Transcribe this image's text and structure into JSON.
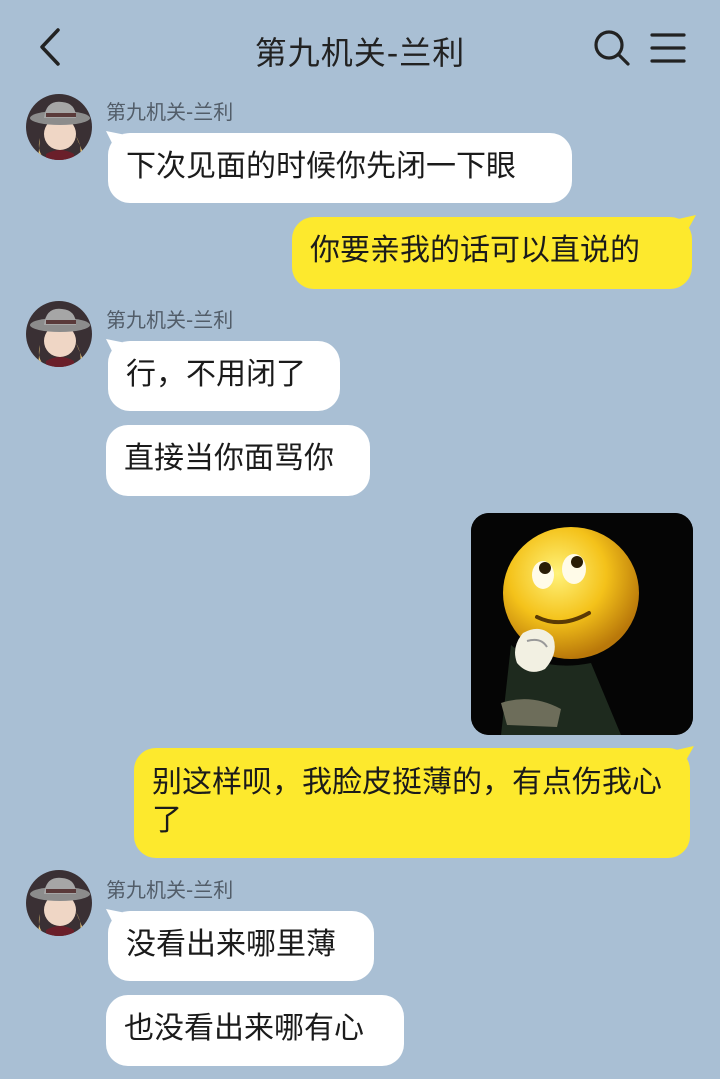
{
  "header": {
    "title": "第九机关-兰利",
    "back_icon": "chevron-left-icon",
    "search_icon": "search-icon",
    "menu_icon": "hamburger-menu-icon"
  },
  "colors": {
    "background": "#a9bfd4",
    "incoming_bubble": "#ffffff",
    "outgoing_bubble": "#fde92d"
  },
  "messages": [
    {
      "direction": "in",
      "sender": "第九机关-兰利",
      "text": "下次见面的时候你先闭一下眼"
    },
    {
      "direction": "out",
      "text": "你要亲我的话可以直说的"
    },
    {
      "direction": "in",
      "sender": "第九机关-兰利",
      "text": "行，不用闭了"
    },
    {
      "direction": "in",
      "text": "直接当你面骂你"
    },
    {
      "direction": "out",
      "type": "image",
      "image": "thinking-emoji-sticker"
    },
    {
      "direction": "out",
      "text": "别这样呗，我脸皮挺薄的，有点伤我心了"
    },
    {
      "direction": "in",
      "sender": "第九机关-兰利",
      "text": "没看出来哪里薄"
    },
    {
      "direction": "in",
      "text": "也没看出来哪有心"
    }
  ]
}
